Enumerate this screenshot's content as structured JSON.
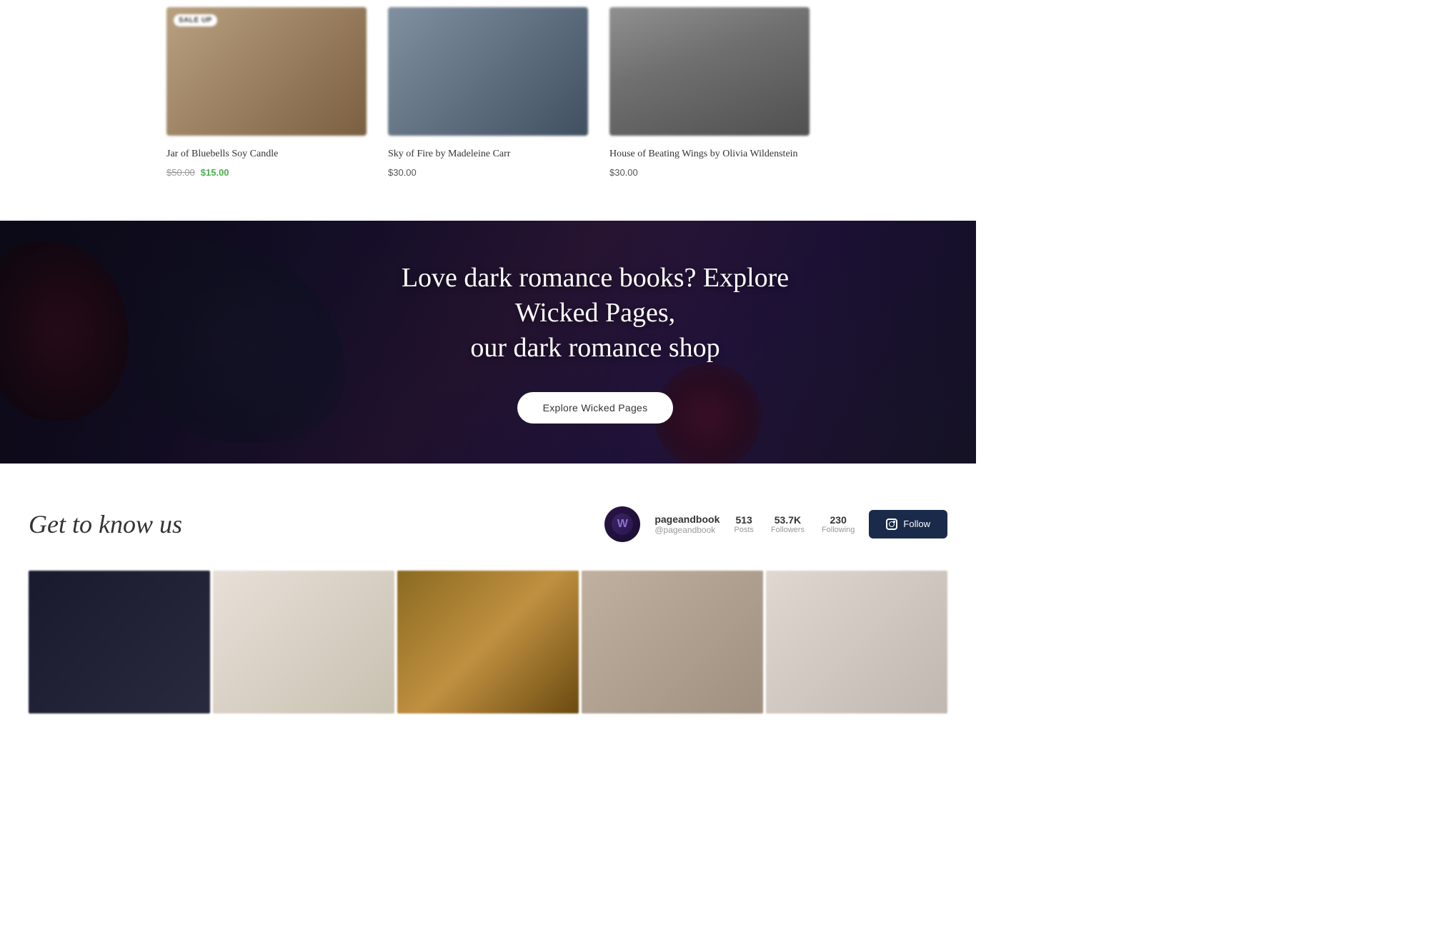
{
  "products": {
    "items": [
      {
        "title": "Jar of Bluebells Soy Candle",
        "price_original": "$50.00",
        "price_sale": "$15.00",
        "has_sale": true,
        "has_sale_badge": true,
        "sale_badge_text": "SALE UP",
        "image_class": "candle"
      },
      {
        "title": "Sky of Fire by Madeleine Carr",
        "price_regular": "$30.00",
        "has_sale": false,
        "image_class": "book1"
      },
      {
        "title": "House of Beating Wings by Olivia Wildenstein",
        "price_regular": "$30.00",
        "has_sale": false,
        "image_class": "book2"
      }
    ]
  },
  "banner": {
    "title_line1": "Love dark romance books? Explore Wicked Pages,",
    "title_line2": "our dark romance shop",
    "button_label": "Explore Wicked Pages"
  },
  "get_to_know": {
    "section_title": "Get to know us",
    "instagram": {
      "handle": "pageandbook",
      "subhandle": "@pageandbook",
      "stats": {
        "posts_count": "513",
        "posts_label": "Posts",
        "followers_count": "53.7K",
        "followers_label": "Followers",
        "following_count": "230",
        "following_label": "Following"
      },
      "follow_button_label": "Follow"
    }
  }
}
